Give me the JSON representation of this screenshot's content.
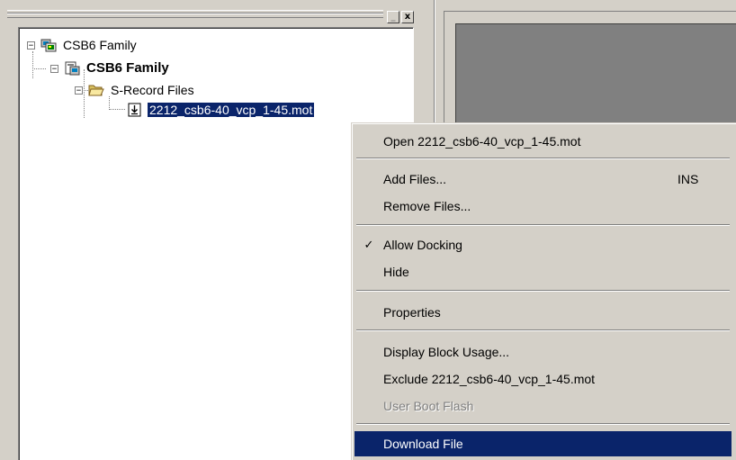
{
  "pane": {
    "minimize_glyph": "_",
    "close_glyph": "x"
  },
  "tree": {
    "root": {
      "label": "CSB6 Family",
      "expander": "−",
      "icon": "workspace-icon"
    },
    "project": {
      "label": "CSB6 Family",
      "expander": "−",
      "icon": "project-icon"
    },
    "folder": {
      "label": "S-Record Files",
      "expander": "−",
      "icon": "folder-open-icon"
    },
    "file": {
      "label": "2212_csb6-40_vcp_1-45.mot",
      "icon": "download-file-icon",
      "selected": true
    }
  },
  "context_menu": {
    "items": [
      {
        "label": "Open 2212_csb6-40_vcp_1-45.mot",
        "shortcut": "",
        "checked": false,
        "enabled": true
      },
      {
        "label": "Add Files...",
        "shortcut": "INS",
        "checked": false,
        "enabled": true
      },
      {
        "label": "Remove Files...",
        "shortcut": "",
        "checked": false,
        "enabled": true
      },
      {
        "label": "Allow Docking",
        "shortcut": "",
        "checked": true,
        "enabled": true,
        "check_glyph": "✓"
      },
      {
        "label": "Hide",
        "shortcut": "",
        "checked": false,
        "enabled": true
      },
      {
        "label": "Properties",
        "shortcut": "",
        "checked": false,
        "enabled": true
      },
      {
        "label": "Display Block Usage...",
        "shortcut": "",
        "checked": false,
        "enabled": true
      },
      {
        "label": "Exclude 2212_csb6-40_vcp_1-45.mot",
        "shortcut": "",
        "checked": false,
        "enabled": true
      },
      {
        "label": "User Boot Flash",
        "shortcut": "",
        "checked": false,
        "enabled": false
      },
      {
        "label": "Download File",
        "shortcut": "",
        "checked": false,
        "enabled": true,
        "highlighted": true
      }
    ]
  },
  "colors": {
    "face": "#d4d0c8",
    "selection": "#0a246a",
    "mdi_background": "#808080",
    "tree_background": "#ffffff"
  }
}
